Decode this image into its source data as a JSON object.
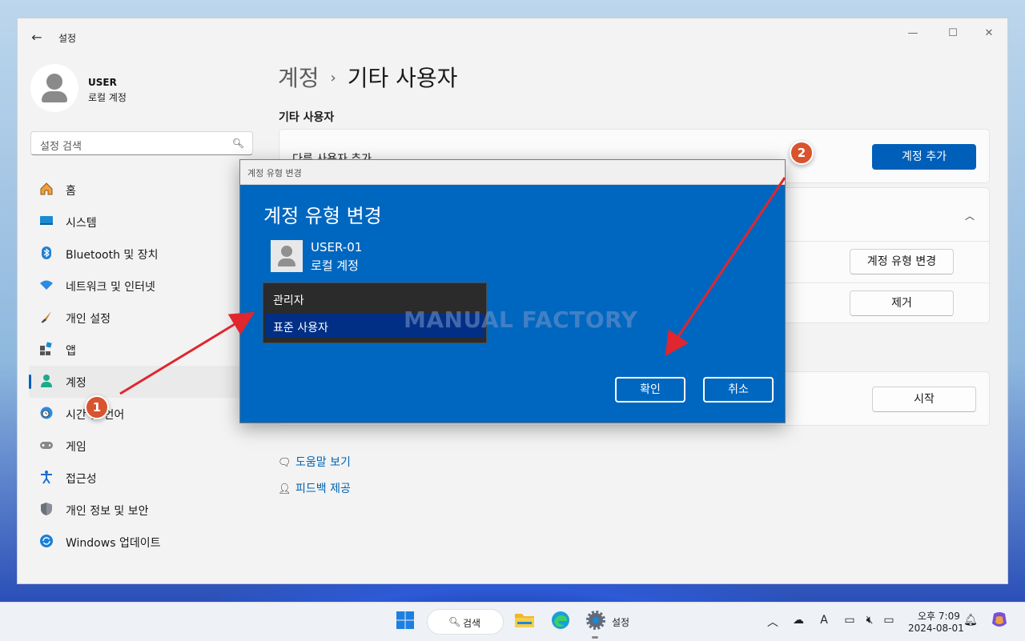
{
  "window": {
    "app_title": "설정",
    "back_glyph": "←",
    "minimize_glyph": "—",
    "maximize_glyph": "☐",
    "close_glyph": "✕"
  },
  "user": {
    "name": "USER",
    "account_type": "로컬 계정"
  },
  "search": {
    "placeholder": "설정 검색"
  },
  "sidebar": {
    "items": [
      {
        "label": "홈",
        "icon": "home-icon"
      },
      {
        "label": "시스템",
        "icon": "system-icon"
      },
      {
        "label": "Bluetooth 및 장치",
        "icon": "bluetooth-icon"
      },
      {
        "label": "네트워크 및 인터넷",
        "icon": "wifi-icon"
      },
      {
        "label": "개인 설정",
        "icon": "brush-icon"
      },
      {
        "label": "앱",
        "icon": "apps-icon"
      },
      {
        "label": "계정",
        "icon": "account-icon",
        "active": true
      },
      {
        "label": "시간 및 언어",
        "icon": "globe-clock-icon"
      },
      {
        "label": "게임",
        "icon": "gamepad-icon"
      },
      {
        "label": "접근성",
        "icon": "accessibility-icon"
      },
      {
        "label": "개인 정보 및 보안",
        "icon": "shield-icon"
      },
      {
        "label": "Windows 업데이트",
        "icon": "update-icon"
      }
    ]
  },
  "main": {
    "breadcrumb_parent": "계정",
    "breadcrumb_sep": "›",
    "breadcrumb_current": "기타 사용자",
    "section_title": "기타 사용자",
    "add_user_text": "다른 사용자 추가",
    "add_account_button": "계정 추가",
    "change_type_button": "계정 유형 변경",
    "remove_button": "제거",
    "start_button": "시작",
    "help_link": "도움말 보기",
    "feedback_link": "피드백 제공"
  },
  "dialog": {
    "title_bar": "계정 유형 변경",
    "heading": "계정 유형 변경",
    "user_name": "USER-01",
    "user_type": "로컬 계정",
    "options": [
      "관리자",
      "표준 사용자"
    ],
    "selected_option": "표준 사용자",
    "ok_button": "확인",
    "cancel_button": "취소",
    "watermark": "MANUAL FACTORY"
  },
  "annotations": {
    "step1": "1",
    "step2": "2",
    "arrow_color": "#e0262e"
  },
  "taskbar": {
    "search_label": "검색",
    "settings_label": "설정",
    "time": "오후 7:09",
    "date": "2024-08-01"
  },
  "colors": {
    "accent": "#005fb8",
    "dialog_blue": "#0067c0",
    "badge": "#d9532f"
  }
}
